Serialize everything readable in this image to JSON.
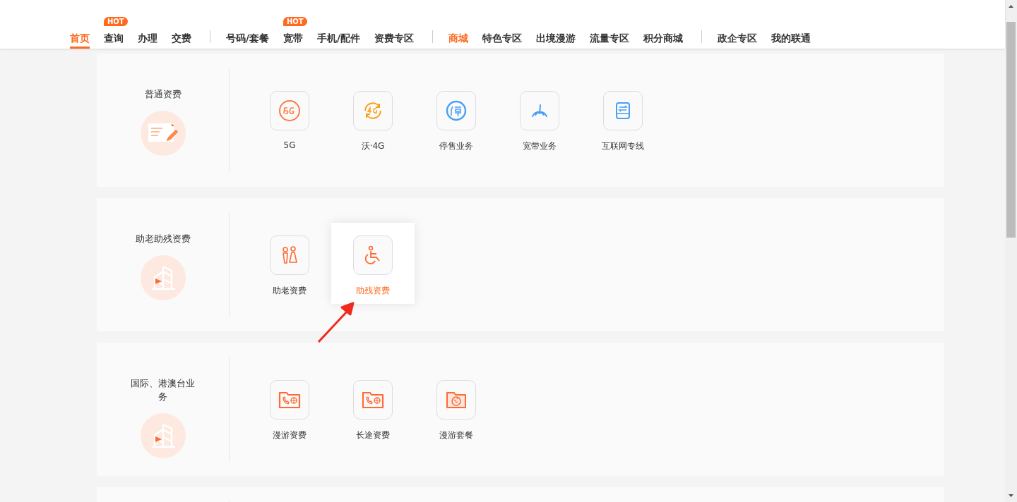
{
  "nav": {
    "groups": [
      [
        {
          "label": "首页",
          "selected": true,
          "kind": "plain"
        },
        {
          "label": "查询",
          "selected": false,
          "kind": "plain",
          "badge": "HOT"
        },
        {
          "label": "办理",
          "selected": false,
          "kind": "plain"
        },
        {
          "label": "交费",
          "selected": false,
          "kind": "plain"
        }
      ],
      [
        {
          "label": "号码/套餐",
          "selected": false,
          "kind": "plain"
        },
        {
          "label": "宽带",
          "selected": false,
          "kind": "plain",
          "badge": "HOT"
        },
        {
          "label": "手机/配件",
          "selected": false,
          "kind": "plain"
        },
        {
          "label": "资费专区",
          "selected": false,
          "kind": "plain"
        }
      ],
      [
        {
          "label": "商城",
          "selected": false,
          "kind": "accent"
        },
        {
          "label": "特色专区",
          "selected": false,
          "kind": "plain"
        },
        {
          "label": "出境漫游",
          "selected": false,
          "kind": "plain"
        },
        {
          "label": "流量专区",
          "selected": false,
          "kind": "plain"
        },
        {
          "label": "积分商城",
          "selected": false,
          "kind": "plain"
        }
      ],
      [
        {
          "label": "政企专区",
          "selected": false,
          "kind": "plain"
        },
        {
          "label": "我的联通",
          "selected": false,
          "kind": "plain"
        }
      ]
    ]
  },
  "sections": [
    {
      "title": "普通资费",
      "kind": "form",
      "items": [
        {
          "label": "5G",
          "kind": "signal",
          "selected": false
        },
        {
          "label": "沃·4G",
          "kind": "cycle",
          "selected": false
        },
        {
          "label": "停售业务",
          "kind": "stop",
          "selected": false
        },
        {
          "label": "宽带业务",
          "kind": "gauge",
          "selected": false
        },
        {
          "label": "互联网专线",
          "kind": "drive",
          "selected": false
        }
      ]
    },
    {
      "title": "助老助残资费",
      "kind": "building",
      "items": [
        {
          "label": "助老资费",
          "kind": "elder",
          "selected": false
        },
        {
          "label": "助残资费",
          "kind": "wheelchair",
          "selected": true
        }
      ]
    },
    {
      "title": "国际、港澳台业务",
      "kind": "building",
      "items": [
        {
          "label": "漫游资费",
          "kind": "phonefolder",
          "selected": false
        },
        {
          "label": "长途资费",
          "kind": "phonefolder",
          "selected": false
        },
        {
          "label": "漫游套餐",
          "kind": "globefolder",
          "selected": false
        }
      ]
    }
  ]
}
